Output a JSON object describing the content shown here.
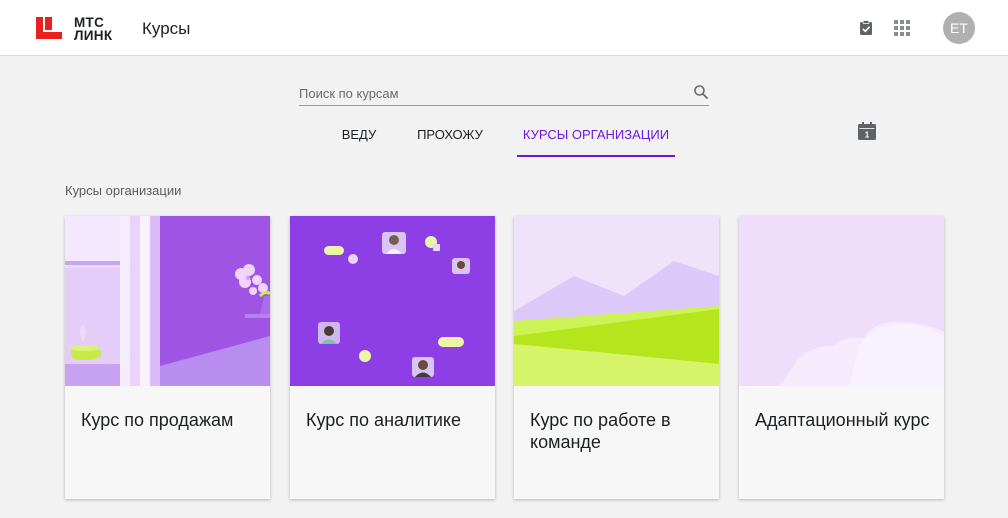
{
  "header": {
    "logo_line1": "МТС",
    "logo_line2": "ЛИНК",
    "title": "Курсы",
    "icons": [
      "task-check-icon",
      "apps-grid-icon"
    ],
    "avatar_initials": "ET"
  },
  "search": {
    "placeholder": "Поиск по курсам",
    "value": ""
  },
  "tabs": [
    {
      "label": "ВЕДУ",
      "active": false
    },
    {
      "label": "ПРОХОЖУ",
      "active": false
    },
    {
      "label": "КУРСЫ ОРГАНИЗАЦИИ",
      "active": true
    }
  ],
  "calendar_day": "1",
  "section": {
    "label": "Курсы организации"
  },
  "courses": [
    {
      "title": "Курс по продажам",
      "cover_icon": "window-flowers-illustration"
    },
    {
      "title": "Курс по аналитике",
      "cover_icon": "avatars-network-illustration"
    },
    {
      "title": "Курс по работе в команде",
      "cover_icon": "hills-landscape-illustration"
    },
    {
      "title": "Адаптационный курс",
      "cover_icon": "clouds-illustration"
    }
  ],
  "colors": {
    "accent": "#6c18d9",
    "brand_red": "#e8211e",
    "background": "#f2f2f2",
    "header_bg": "#ffffff"
  }
}
